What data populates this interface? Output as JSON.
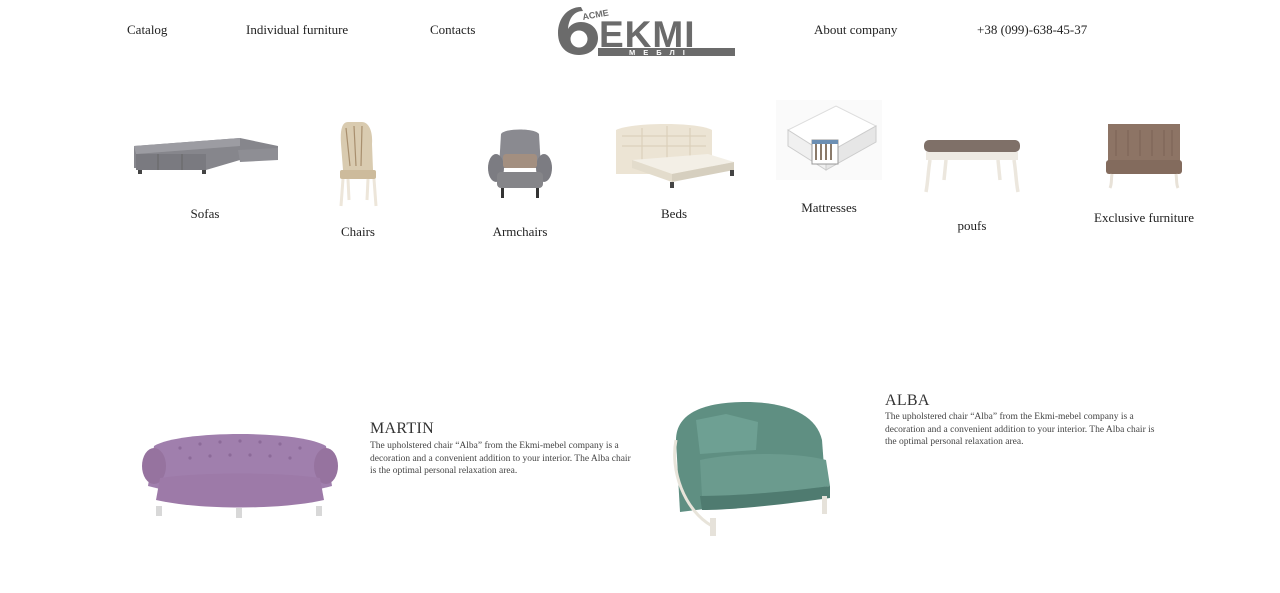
{
  "nav": {
    "catalog": "Catalog",
    "individual": "Individual furniture",
    "contacts": "Contacts",
    "about": "About company",
    "phone": "+38 (099)-638-45-37"
  },
  "logo": {
    "main": "EKMI",
    "arc_text": "ACME",
    "sub": "МЕБЛІ"
  },
  "categories": [
    {
      "label": "Sofas",
      "icon": "sofa-image"
    },
    {
      "label": "Chairs",
      "icon": "chair-image"
    },
    {
      "label": "Armchairs",
      "icon": "armchair-image"
    },
    {
      "label": "Beds",
      "icon": "bed-image"
    },
    {
      "label": "Mattresses",
      "icon": "mattress-image"
    },
    {
      "label": "poufs",
      "icon": "pouf-image"
    },
    {
      "label": "Exclusive furniture",
      "icon": "exclusive-sofa-image"
    }
  ],
  "products": [
    {
      "title": "MARTIN",
      "description": "The upholstered chair “Alba” from the Ekmi-mebel company is a decoration and a convenient addition to your interior. The Alba chair is the optimal personal relaxation area."
    },
    {
      "title": "ALBA",
      "description": "The upholstered chair “Alba” from the Ekmi-mebel company is a decoration and a convenient addition to your interior. The Alba chair is the optimal personal relaxation area."
    }
  ],
  "colors": {
    "text": "#222222",
    "logo_gray": "#6b6b6b",
    "sofa_gray": "#8a8a90",
    "velvet_purple": "#a07fad",
    "velvet_green": "#5f8f82",
    "cream": "#ece3d6",
    "brown": "#8a7263"
  }
}
